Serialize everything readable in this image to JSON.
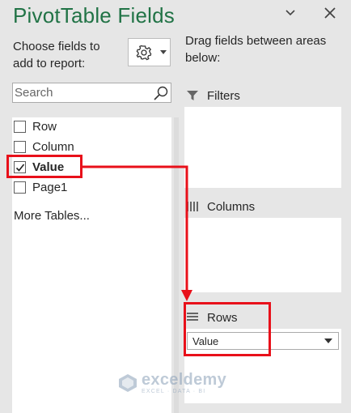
{
  "panel": {
    "title": "PivotTable Fields",
    "choose_text": "Choose fields to add to report:",
    "drag_text": "Drag fields between areas below:"
  },
  "search": {
    "placeholder": "Search",
    "value": ""
  },
  "fields": [
    {
      "label": "Row",
      "checked": false
    },
    {
      "label": "Column",
      "checked": false
    },
    {
      "label": "Value",
      "checked": true
    },
    {
      "label": "Page1",
      "checked": false
    }
  ],
  "more_tables": "More Tables...",
  "areas": {
    "filters": {
      "label": "Filters"
    },
    "columns": {
      "label": "Columns"
    },
    "rows": {
      "label": "Rows",
      "items": [
        {
          "label": "Value"
        }
      ]
    }
  },
  "watermark": {
    "name": "exceldemy",
    "tagline": "EXCEL · DATA · BI"
  },
  "colors": {
    "title": "#217346",
    "highlight": "#e8101a"
  },
  "icons": {
    "dropdown": "dropdown-chevron-icon",
    "close": "close-icon",
    "gear": "gear-icon",
    "search": "search-icon",
    "filter": "filter-icon",
    "columns": "columns-icon",
    "rows": "rows-icon"
  }
}
